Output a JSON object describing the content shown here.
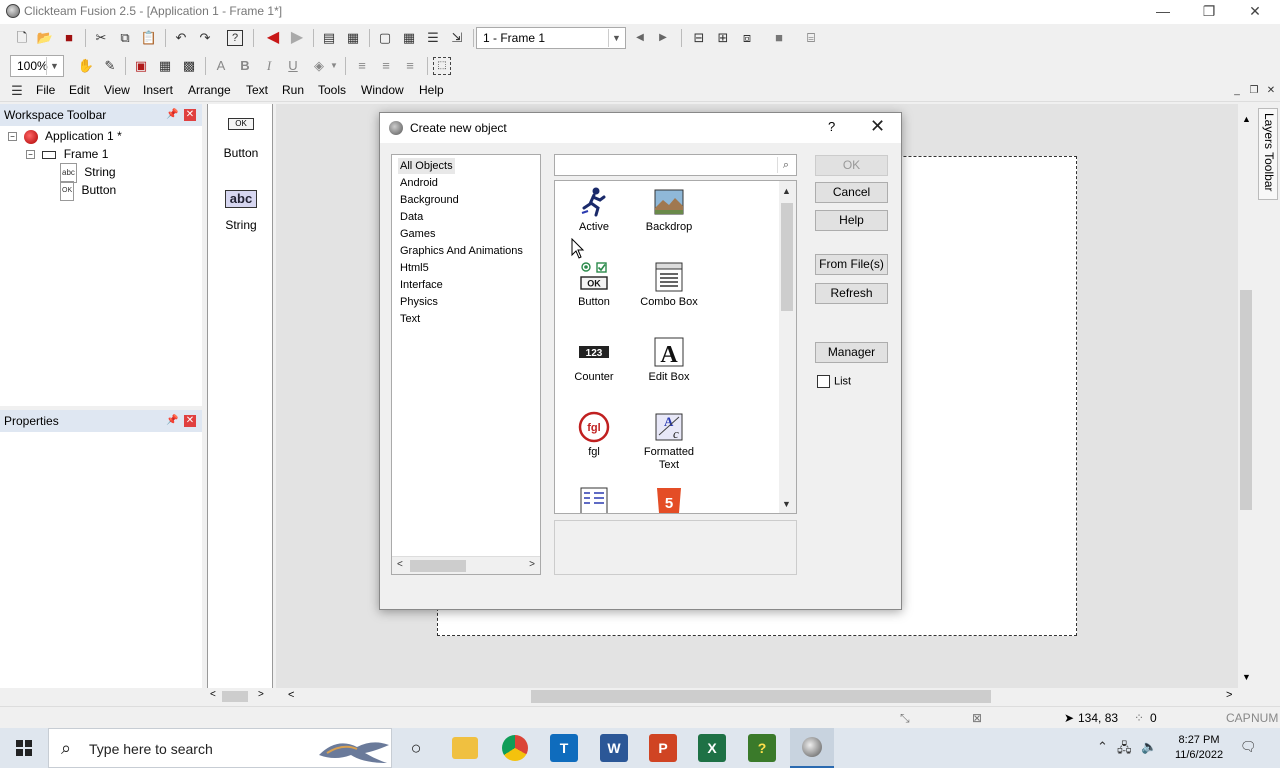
{
  "window": {
    "title": "Clickteam Fusion 2.5 - [Application 1 - Frame 1*]",
    "minimize": "—",
    "restore": "❐",
    "close": "✕"
  },
  "toolbar": {
    "frame_select": "1 - Frame 1",
    "zoom": "100%"
  },
  "menu": {
    "items": [
      "File",
      "Edit",
      "View",
      "Insert",
      "Arrange",
      "Text",
      "Run",
      "Tools",
      "Window",
      "Help"
    ]
  },
  "workspace": {
    "title": "Workspace Toolbar",
    "tree": {
      "app": "Application 1 *",
      "frame": "Frame 1",
      "children": [
        "String",
        "Button"
      ]
    }
  },
  "properties": {
    "title": "Properties"
  },
  "object_toolbar": {
    "items": [
      "Button",
      "String"
    ],
    "button_icon_text": "OK",
    "string_icon_text": "abc"
  },
  "layers_toolbar": {
    "label": "Layers Toolbar"
  },
  "dialog": {
    "title": "Create new object",
    "help": "?",
    "close": "✕",
    "categories": [
      "All Objects",
      "Android",
      "Background",
      "Data",
      "Games",
      "Graphics And Animations",
      "Html5",
      "Interface",
      "Physics",
      "Text"
    ],
    "selected_category": "All Objects",
    "search_placeholder": "",
    "objects": [
      {
        "label": "Active",
        "icon": "running-man-icon"
      },
      {
        "label": "Backdrop",
        "icon": "landscape-icon"
      },
      {
        "label": "Button",
        "icon": "ok-button-icon"
      },
      {
        "label": "Combo Box",
        "icon": "combo-box-icon"
      },
      {
        "label": "Counter",
        "icon": "counter-icon"
      },
      {
        "label": "Edit Box",
        "icon": "letter-a-icon"
      },
      {
        "label": "fgl",
        "icon": "fgl-icon"
      },
      {
        "label": "Formatted Text",
        "icon": "formatted-text-icon"
      }
    ],
    "icon_texts": {
      "ok": "OK",
      "counter": "123",
      "edit_a": "A",
      "fgl": "fgl",
      "html5": "5"
    },
    "buttons": {
      "ok": "OK",
      "cancel": "Cancel",
      "help": "Help",
      "from_files": "From File(s)",
      "refresh": "Refresh",
      "manager": "Manager"
    },
    "list_checkbox": "List"
  },
  "statusbar": {
    "coords": "134, 83",
    "count": "0",
    "caps": "CAP",
    "num": "NUM"
  },
  "taskbar": {
    "search_placeholder": "Type here to search",
    "time": "8:27 PM",
    "date": "11/6/2022"
  },
  "colors": {
    "accent_red": "#e04040",
    "panel_header": "#dfe7f2"
  }
}
